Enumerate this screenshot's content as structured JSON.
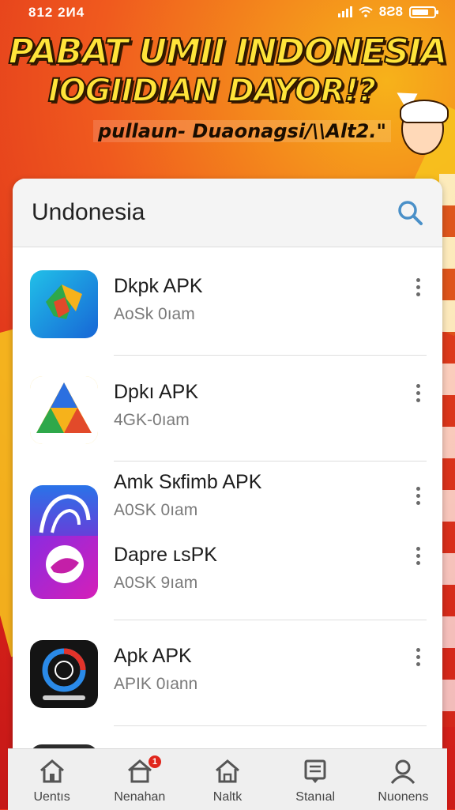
{
  "status_bar": {
    "time": "812 2И4",
    "battery_text": "8Ƨ8",
    "battery_level": 0.75
  },
  "banner": {
    "title_line1": "PABAT UMII INDONESIA",
    "title_line2": "IOGIIDIAN DAYOR!?",
    "subtitle": "pullaun- Duaonagsi/\\\\Alt2.\""
  },
  "search": {
    "value": "Undonesia",
    "icon": "search-icon"
  },
  "apps": [
    {
      "name": "Dkpk APK",
      "meta": "AoЅk 0ıam",
      "icon": "green-diamond-app-icon"
    },
    {
      "name": "Dpkı APK",
      "meta": "4GK-0ıam",
      "icon": "triangle-app-icon"
    },
    {
      "name": "Amk Sкfimb APK",
      "meta": "A0ЅK 0ıam",
      "icon": "blue-bird-app-icon"
    },
    {
      "name": "Dapre ʟsPK",
      "meta": "A0ЅK 9ıam",
      "icon": "purple-swirl-app-icon"
    },
    {
      "name": "Apk APK",
      "meta": "APIK 0ıann",
      "icon": "dark-ring-app-icon"
    }
  ],
  "bottom_nav": [
    {
      "label": "Uentıs",
      "icon": "home-icon"
    },
    {
      "label": "Nenahan",
      "icon": "inbox-icon",
      "badge": "1"
    },
    {
      "label": "Naltk",
      "icon": "house-icon"
    },
    {
      "label": "Stanıal",
      "icon": "document-icon"
    },
    {
      "label": "Nuonens",
      "icon": "profile-icon"
    }
  ]
}
